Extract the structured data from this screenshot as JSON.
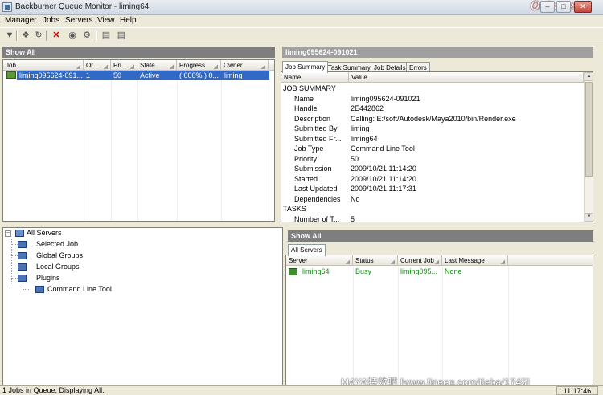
{
  "window": {
    "title": "Backburner Queue Monitor - liming64",
    "logo_text": "Oeio.net"
  },
  "menu": [
    "Manager",
    "Jobs",
    "Servers",
    "View",
    "Help"
  ],
  "toolbar_icons": [
    "activate-job-icon",
    "assign-icon",
    "refresh-icon",
    "delete-icon",
    "suspend-icon",
    "restart-icon",
    "archive-icon",
    "settings-icon"
  ],
  "jobs_panel": {
    "header": "Show All",
    "columns": [
      "Job",
      "Or...",
      "Pri...",
      "State",
      "Progress",
      "Owner"
    ],
    "rows": [
      {
        "job": "liming095624-091...",
        "order": "1",
        "priority": "50",
        "state": "Active",
        "progress": "( 000% ) 0...",
        "owner": "liming"
      }
    ]
  },
  "details_panel": {
    "header": "liming095624-091021",
    "tabs": [
      "Job Summary",
      "Task Summary",
      "Job Details",
      "Errors"
    ],
    "columns": [
      "Name",
      "Value"
    ],
    "section_job": "JOB SUMMARY",
    "props": [
      {
        "name": "Name",
        "value": "liming095624-091021"
      },
      {
        "name": "Handle",
        "value": "2E442862"
      },
      {
        "name": "Description",
        "value": "Calling: E:/soft/Autodesk/Maya2010/bin/Render.exe"
      },
      {
        "name": "Submitted By",
        "value": "liming"
      },
      {
        "name": "Submitted Fr...",
        "value": "liming64"
      },
      {
        "name": "Job Type",
        "value": "Command Line Tool"
      },
      {
        "name": "Priority",
        "value": "50"
      },
      {
        "name": "Submission",
        "value": "2009/10/21 11:14:20"
      },
      {
        "name": "Started",
        "value": "2009/10/21 11:14:20"
      },
      {
        "name": "Last Updated",
        "value": "2009/10/21 11:17:31"
      },
      {
        "name": "Dependencies",
        "value": "No"
      }
    ],
    "section_tasks": "TASKS",
    "task_props": [
      {
        "name": "Number of T...",
        "value": "5"
      }
    ]
  },
  "tree": {
    "root": "All Servers",
    "selected_job": "Selected Job",
    "global_groups": "Global Groups",
    "local_groups": "Local Groups",
    "plugins": "Plugins",
    "command_line_tool": "Command Line Tool"
  },
  "servers_panel": {
    "header": "Show All",
    "tab": "All Servers",
    "columns": [
      "Server",
      "Status",
      "Current Job",
      "Last Message"
    ],
    "rows": [
      {
        "server": "liming64",
        "status": "Busy",
        "current_job": "liming095...",
        "last_message": "None"
      }
    ]
  },
  "status": {
    "left": "1 Jobs in Queue, Displaying All.",
    "time": "11:17:46"
  },
  "watermark": "MAYA特效吧  [www.lineeg.com/tieba/1745]"
}
